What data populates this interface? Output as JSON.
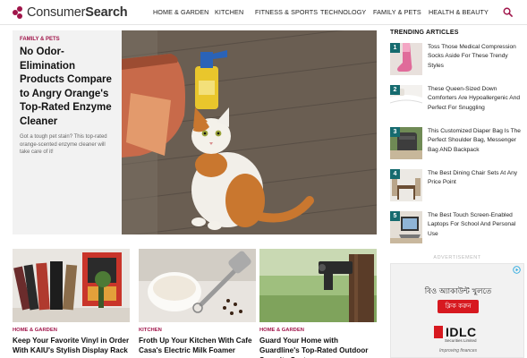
{
  "logo": {
    "brand_light": "Consumer",
    "brand_bold": "Search"
  },
  "nav": {
    "items": [
      "HOME & GARDEN",
      "KITCHEN",
      "FITNESS & SPORTS",
      "TECHNOLOGY",
      "FAMILY & PETS",
      "HEALTH & BEAUTY"
    ],
    "search_icon": "search-icon"
  },
  "hero": {
    "category": "FAMILY & PETS",
    "title": "No Odor-Elimination Products Compare to Angry Orange's Top-Rated Enzyme Cleaner",
    "description": "Got a tough pet stain? This top-rated orange-scented enzyme cleaner will take care of it!"
  },
  "cards": [
    {
      "category": "HOME & GARDEN",
      "title": "Keep Your Favorite Vinyl in Order With KAIU's Stylish Display Rack"
    },
    {
      "category": "KITCHEN",
      "title": "Froth Up Your Kitchen With Cafe Casa's Electric Milk Foamer"
    },
    {
      "category": "HOME & GARDEN",
      "title": "Guard Your Home with Guardline's Top-Rated Outdoor Security System"
    }
  ],
  "trending": {
    "heading": "TRENDING ARTICLES",
    "items": [
      {
        "num": "1",
        "text": "Toss Those Medical Compression Socks Aside For These Trendy Styles"
      },
      {
        "num": "2",
        "text": "These Queen-Sized Down Comforters Are Hypoallergenic And Perfect For Snuggling"
      },
      {
        "num": "3",
        "text": "This Customized Diaper Bag Is The Perfect Shoulder Bag, Messenger Bag AND Backpack"
      },
      {
        "num": "4",
        "text": "The Best Dining Chair Sets At Any Price Point"
      },
      {
        "num": "5",
        "text": "The Best Touch Screen-Enabled Laptops For School And Personal Use"
      }
    ]
  },
  "ad": {
    "label": "ADVERTISEMENT",
    "headline": "বিও অ্যাকাউন্ট খুলতে",
    "cta": "ক্লিক করুন",
    "brand": "IDLC",
    "brand_sub": "Securities Limited",
    "tagline": "Improving finances"
  },
  "colors": {
    "accent": "#a0154a",
    "trend_badge": "#166b6f",
    "ad_cta": "#d71920"
  }
}
